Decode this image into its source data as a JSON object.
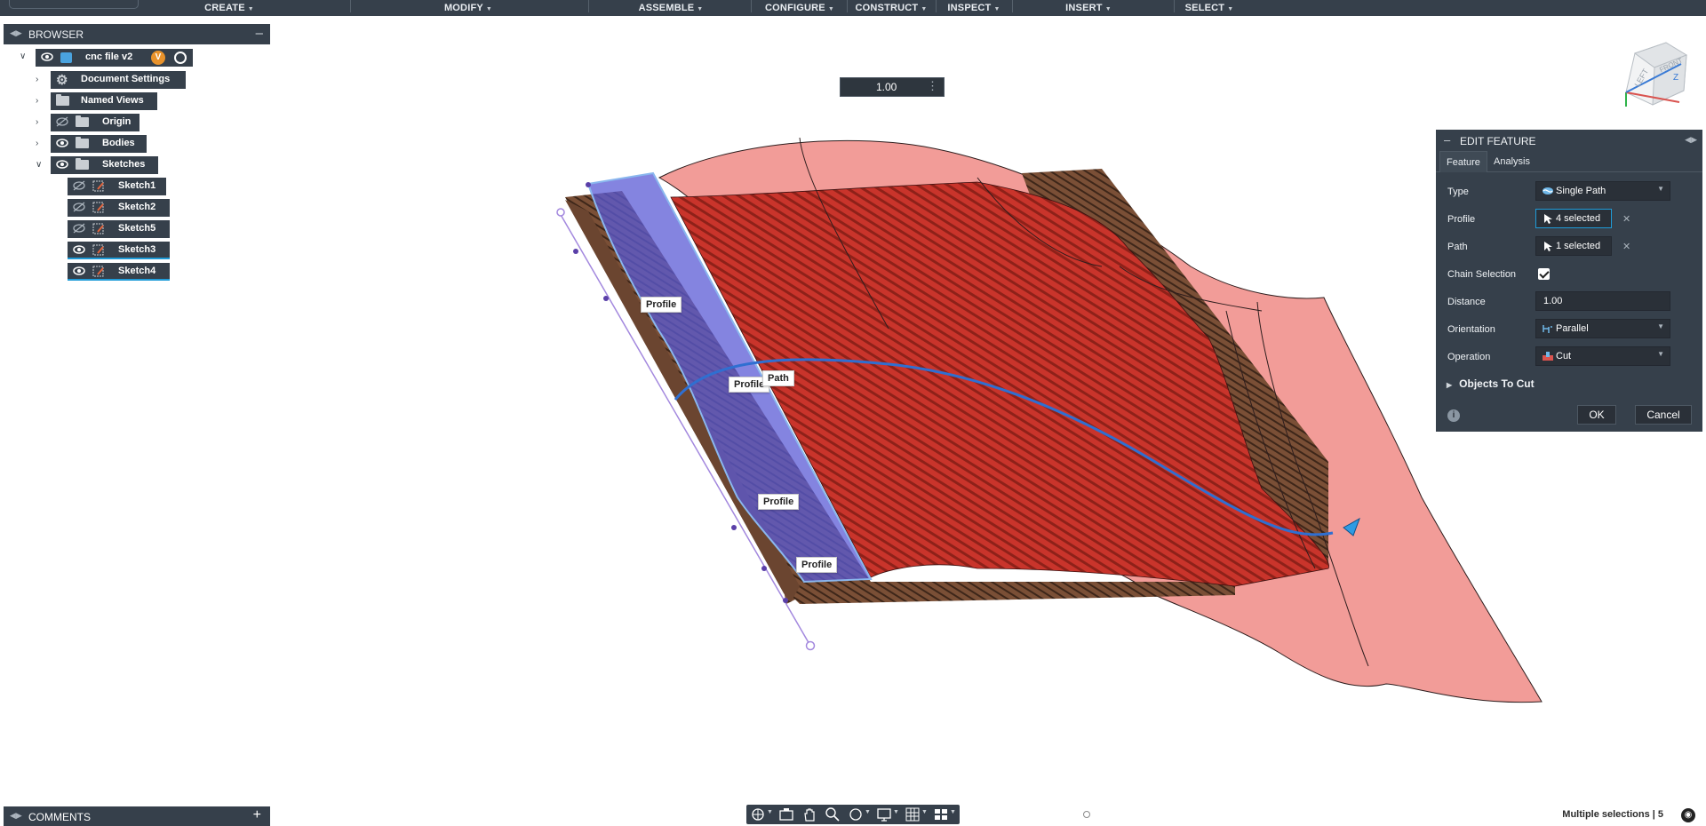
{
  "toolbar": {
    "menus": [
      {
        "label": "CREATE"
      },
      {
        "label": "MODIFY"
      },
      {
        "label": "ASSEMBLE"
      },
      {
        "label": "CONFIGURE"
      },
      {
        "label": "CONSTRUCT"
      },
      {
        "label": "INSPECT"
      },
      {
        "label": "INSERT"
      },
      {
        "label": "SELECT"
      }
    ],
    "dropdown_icon": "caret-down-icon"
  },
  "browser": {
    "title": "BROWSER",
    "collapse_icon": "minus-icon",
    "root": {
      "label": "cnc file v2",
      "badge": "V"
    },
    "items": [
      {
        "label": "Document Settings",
        "icon": "gear-icon"
      },
      {
        "label": "Named Views",
        "icon": "folder-icon"
      },
      {
        "label": "Origin",
        "icon": "folder-icon"
      },
      {
        "label": "Bodies",
        "icon": "folder-icon"
      },
      {
        "label": "Sketches",
        "icon": "folder-icon"
      }
    ],
    "sketches": [
      {
        "label": "Sketch1"
      },
      {
        "label": "Sketch2"
      },
      {
        "label": "Sketch5"
      },
      {
        "label": "Sketch3"
      },
      {
        "label": "Sketch4"
      }
    ]
  },
  "comments": {
    "title": "COMMENTS",
    "add_icon": "plus-icon"
  },
  "distance_input": {
    "value": "1.00"
  },
  "viewport_labels": {
    "profile": "Profile",
    "path": "Path"
  },
  "dialog": {
    "title": "EDIT FEATURE",
    "tabs": [
      {
        "label": "Feature"
      },
      {
        "label": "Analysis"
      }
    ],
    "rows": {
      "type": {
        "label": "Type",
        "value": "Single Path"
      },
      "profile": {
        "label": "Profile",
        "value": "4 selected"
      },
      "path": {
        "label": "Path",
        "value": "1 selected"
      },
      "chain": {
        "label": "Chain Selection",
        "checked": true
      },
      "distance": {
        "label": "Distance",
        "value": "1.00"
      },
      "orientation": {
        "label": "Orientation",
        "value": "Parallel"
      },
      "operation": {
        "label": "Operation",
        "value": "Cut"
      }
    },
    "objects_to_cut": "Objects To Cut",
    "ok": "OK",
    "cancel": "Cancel"
  },
  "viewcube": {
    "face_left": "LEFT",
    "face_front": "FRONT",
    "axis_z": "Z"
  },
  "status": {
    "text": "Multiple selections | 5"
  }
}
